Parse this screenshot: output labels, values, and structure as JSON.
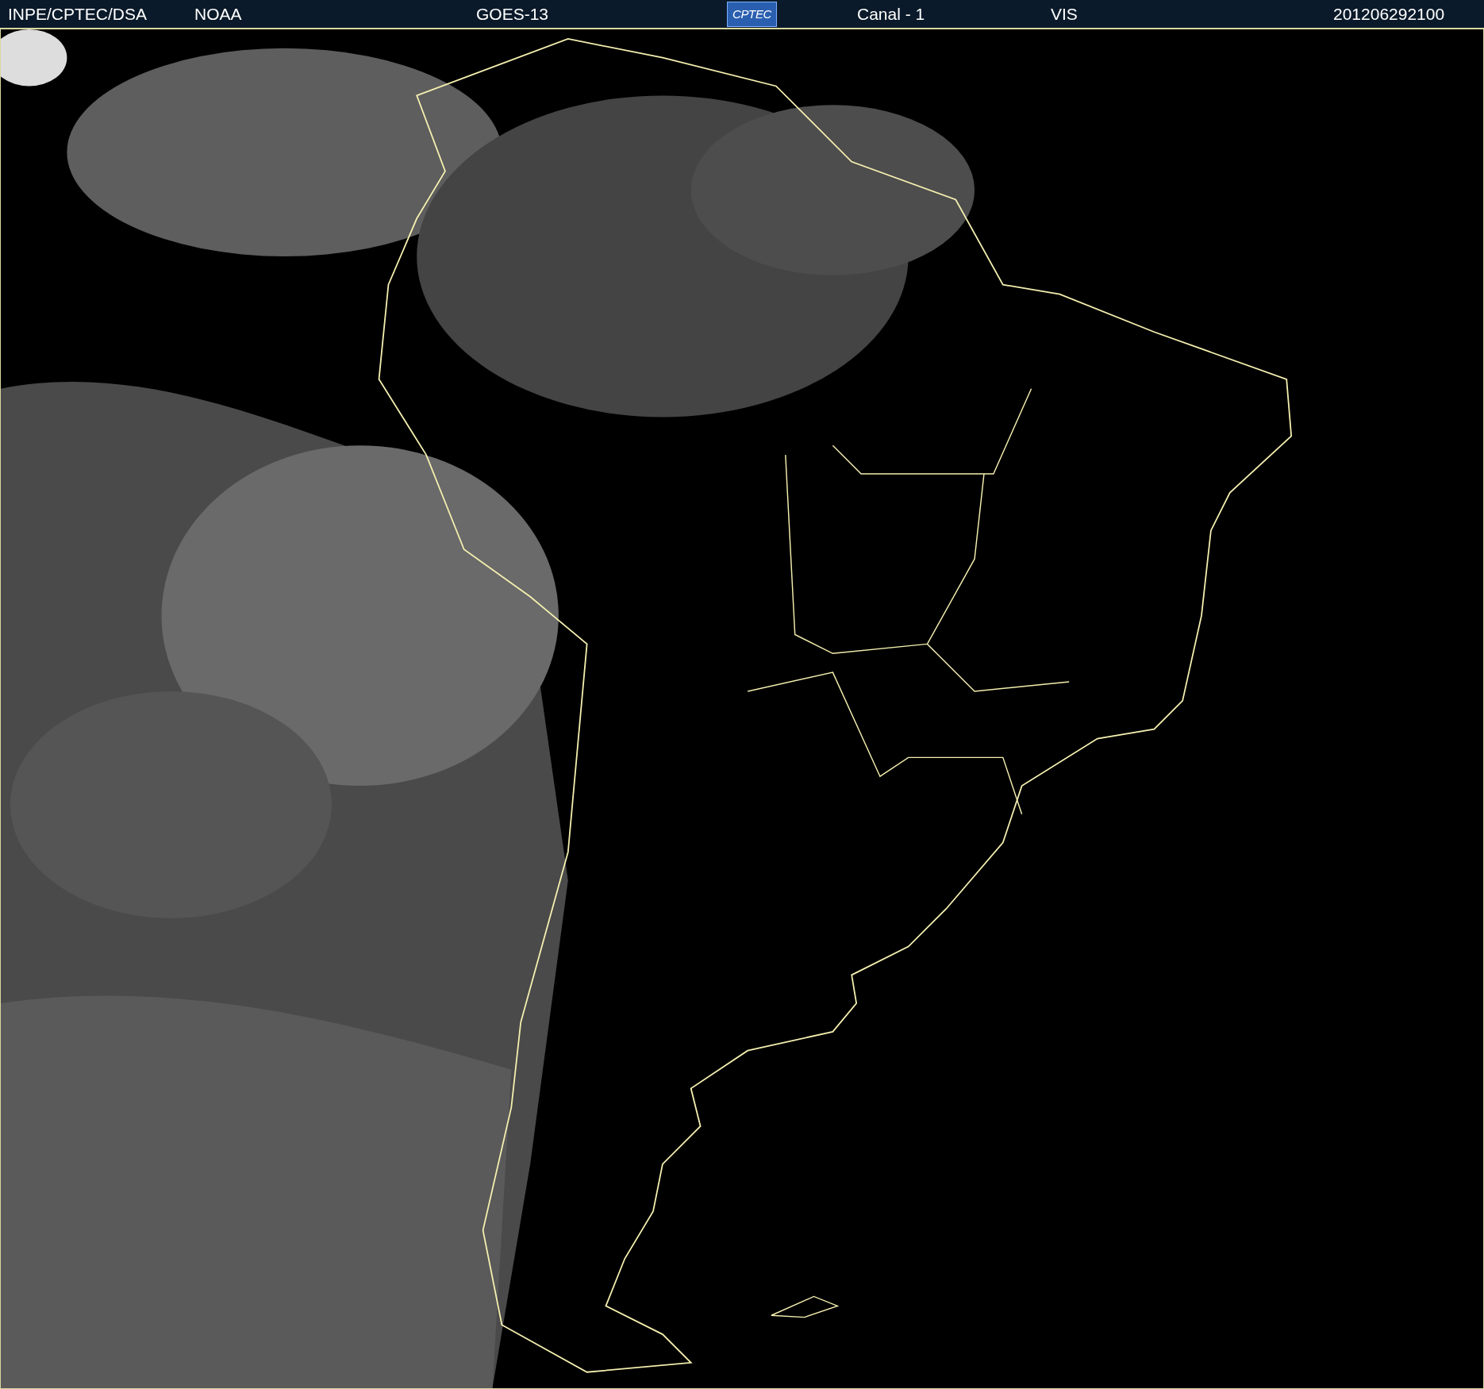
{
  "header": {
    "items": [
      {
        "kind": "text",
        "text": "INPE/CPTEC/DSA"
      },
      {
        "kind": "text",
        "text": "NOAA"
      },
      {
        "kind": "text",
        "text": "GOES-13"
      },
      {
        "kind": "logo",
        "text": "CPTEC"
      },
      {
        "kind": "text",
        "text": "Canal - 1"
      },
      {
        "kind": "text",
        "text": "VIS"
      },
      {
        "kind": "text",
        "text": "201206292100"
      }
    ]
  }
}
